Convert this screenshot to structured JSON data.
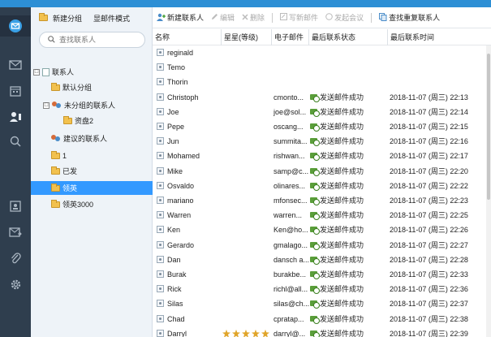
{
  "rail": {
    "items": [
      {
        "icon": "mail-logo-icon",
        "active": true
      },
      {
        "icon": "envelope-icon"
      },
      {
        "icon": "calendar-icon"
      },
      {
        "icon": "contacts-icon"
      },
      {
        "icon": "search-icon"
      },
      {
        "icon": "contact-card-icon"
      },
      {
        "icon": "send-mail-icon"
      },
      {
        "icon": "attachment-icon"
      },
      {
        "icon": "settings-icon"
      }
    ]
  },
  "tree": {
    "new_group": "新建分组",
    "display_mode": "显邮件模式",
    "search_placeholder": "查找联系人",
    "nodes": [
      {
        "label": "联系人",
        "type": "root",
        "expander": "□"
      },
      {
        "label": "默认分组",
        "type": "folder"
      },
      {
        "label": "未分组的联系人",
        "type": "group",
        "expander": "□"
      },
      {
        "label": "资盘2",
        "type": "folder"
      },
      {
        "label": "建议的联系人",
        "type": "group"
      },
      {
        "label": "1",
        "type": "folder"
      },
      {
        "label": "已发",
        "type": "folder"
      },
      {
        "label": "领英",
        "type": "folder",
        "selected": true
      },
      {
        "label": "领英3000",
        "type": "folder"
      }
    ]
  },
  "toolbar": {
    "new_contact": "新建联系人",
    "edit": "编辑",
    "delete": "删除",
    "write_mail": "写新邮件",
    "meeting": "发起会议",
    "find_duplicates": "查找重复联系人"
  },
  "table": {
    "columns": [
      "名称",
      "星星(等级)",
      "电子邮件",
      "最后联系状态",
      "最后联系时间"
    ],
    "rows": [
      {
        "name": "reginald",
        "email": "",
        "status": "",
        "time": ""
      },
      {
        "name": "Temo",
        "email": "",
        "status": "",
        "time": ""
      },
      {
        "name": "Thorin",
        "email": "",
        "status": "",
        "time": ""
      },
      {
        "name": "Christoph",
        "email": "cmonto...",
        "status": "发送邮件成功",
        "time": "2018-11-07 (周三) 22:13"
      },
      {
        "name": "Joe",
        "email": "joe@sol...",
        "status": "发送邮件成功",
        "time": "2018-11-07 (周三) 22:14"
      },
      {
        "name": "Pepe",
        "email": "oscang...",
        "status": "发送邮件成功",
        "time": "2018-11-07 (周三) 22:15"
      },
      {
        "name": "Jun",
        "email": "summita...",
        "status": "发送邮件成功",
        "time": "2018-11-07 (周三) 22:16"
      },
      {
        "name": "Mohamed",
        "email": "rishwan...",
        "status": "发送邮件成功",
        "time": "2018-11-07 (周三) 22:17"
      },
      {
        "name": "Mike",
        "email": "samp@c...",
        "status": "发送邮件成功",
        "time": "2018-11-07 (周三) 22:20"
      },
      {
        "name": "Osvaldo",
        "email": "olinares...",
        "status": "发送邮件成功",
        "time": "2018-11-07 (周三) 22:22"
      },
      {
        "name": "mariano",
        "email": "mfonsec...",
        "status": "发送邮件成功",
        "time": "2018-11-07 (周三) 22:23"
      },
      {
        "name": "Warren",
        "email": "warren...",
        "status": "发送邮件成功",
        "time": "2018-11-07 (周三) 22:25"
      },
      {
        "name": "Ken",
        "email": "Ken@ho...",
        "status": "发送邮件成功",
        "time": "2018-11-07 (周三) 22:26"
      },
      {
        "name": "Gerardo",
        "email": "gmalago...",
        "status": "发送邮件成功",
        "time": "2018-11-07 (周三) 22:27"
      },
      {
        "name": "Dan",
        "email": "dansch a...",
        "status": "发送邮件成功",
        "time": "2018-11-07 (周三) 22:28"
      },
      {
        "name": "Burak",
        "email": "burakbe...",
        "status": "发送邮件成功",
        "time": "2018-11-07 (周三) 22:33"
      },
      {
        "name": "Rick",
        "email": "richl@all...",
        "status": "发送邮件成功",
        "time": "2018-11-07 (周三) 22:36"
      },
      {
        "name": "Silas",
        "email": "silas@ch...",
        "status": "发送邮件成功",
        "time": "2018-11-07 (周三) 22:37"
      },
      {
        "name": "Chad",
        "email": "cpratap...",
        "status": "发送邮件成功",
        "time": "2018-11-07 (周三) 22:38"
      },
      {
        "name": "Darryl",
        "stars": 5,
        "email": "darryl@...",
        "status": "发送邮件成功",
        "time": "2018-11-07 (周三) 22:39"
      }
    ]
  },
  "colors": {
    "accent": "#2d8fd5",
    "rail": "#2f3e4e",
    "selected": "#3399ff",
    "status_green": "#5a9e3a"
  }
}
